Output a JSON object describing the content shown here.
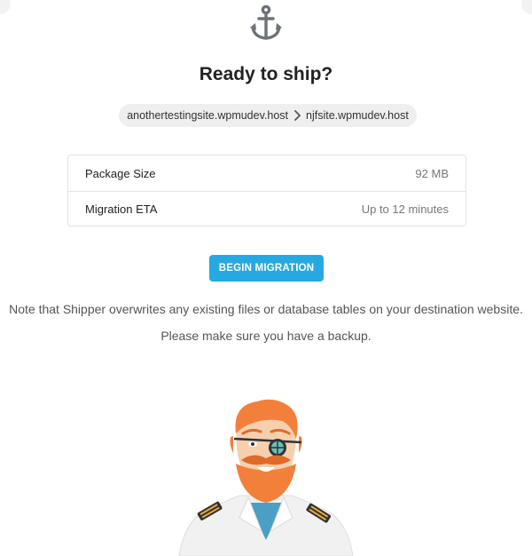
{
  "header": {
    "icon": "anchor-icon",
    "title": "Ready to ship?"
  },
  "route": {
    "source": "anothertestingsite.wpmudev.host",
    "separator_icon": "chevron-right-icon",
    "destination": "njfsite.wpmudev.host"
  },
  "summary": {
    "rows": [
      {
        "label": "Package Size",
        "value": "92 MB"
      },
      {
        "label": "Migration ETA",
        "value": "Up to 12 minutes"
      }
    ]
  },
  "actions": {
    "begin_label": "BEGIN MIGRATION",
    "button_color": "#26a9e0"
  },
  "notice": {
    "line1": "Note that Shipper overwrites any existing files or database tables on your destination website.",
    "line2": "Please make sure you have a backup."
  },
  "illustration": {
    "icon": "captain-mascot-illustration"
  }
}
